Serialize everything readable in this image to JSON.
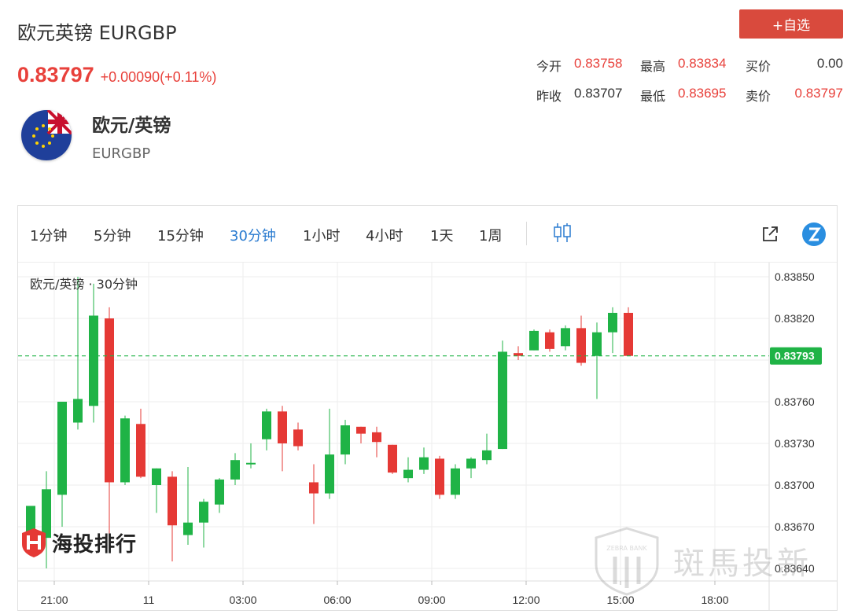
{
  "header": {
    "title": "欧元英镑 EURGBP",
    "price": "0.83797",
    "change": "+0.00090(+0.11%)",
    "add_watch": "+自选"
  },
  "quote": {
    "open_label": "今开",
    "open": "0.83758",
    "high_label": "最高",
    "high": "0.83834",
    "bid_label": "买价",
    "bid": "0.00",
    "prev_label": "昨收",
    "prev": "0.83707",
    "low_label": "最低",
    "low": "0.83695",
    "ask_label": "卖价",
    "ask": "0.83797"
  },
  "pair": {
    "name": "欧元/英镑",
    "code": "EURGBP"
  },
  "toolbar": {
    "timeframes": [
      "1分钟",
      "5分钟",
      "15分钟",
      "30分钟",
      "1小时",
      "4小时",
      "1天",
      "1周"
    ],
    "active": "30分钟"
  },
  "chart_label": "欧元/英镑 · 30分钟",
  "watermarks": {
    "left": "海投排行",
    "right": "斑馬投新",
    "badge": "ZEBRA BANK"
  },
  "colors": {
    "up": "#1fb346",
    "down": "#e53935",
    "accent": "#2a7bd0",
    "brand": "#d94a3d"
  },
  "chart_data": {
    "type": "candlestick",
    "ylim": [
      0.83625,
      0.83855
    ],
    "yticks": [
      "0.83850",
      "0.83820",
      "0.83790",
      "0.83760",
      "0.83730",
      "0.83700",
      "0.83670",
      "0.83640"
    ],
    "xticks": [
      {
        "label": "21:00",
        "index": 1.5
      },
      {
        "label": "11",
        "index": 7.5
      },
      {
        "label": "03:00",
        "index": 13.5
      },
      {
        "label": "06:00",
        "index": 19.5
      },
      {
        "label": "09:00",
        "index": 25.5
      },
      {
        "label": "12:00",
        "index": 31.5
      },
      {
        "label": "15:00",
        "index": 37.5
      },
      {
        "label": "18:00",
        "index": 43.5
      }
    ],
    "last_price": "0.83793",
    "last_value": 0.83793,
    "candles": [
      {
        "o": 0.8366,
        "h": 0.83685,
        "l": 0.8365,
        "c": 0.83685
      },
      {
        "o": 0.83662,
        "h": 0.8371,
        "l": 0.8364,
        "c": 0.83697
      },
      {
        "o": 0.83693,
        "h": 0.8376,
        "l": 0.8367,
        "c": 0.8376
      },
      {
        "o": 0.83745,
        "h": 0.8385,
        "l": 0.8374,
        "c": 0.83762
      },
      {
        "o": 0.83757,
        "h": 0.83845,
        "l": 0.83745,
        "c": 0.83822
      },
      {
        "o": 0.8382,
        "h": 0.83828,
        "l": 0.83665,
        "c": 0.83702
      },
      {
        "o": 0.83702,
        "h": 0.8375,
        "l": 0.837,
        "c": 0.83748
      },
      {
        "o": 0.83744,
        "h": 0.83755,
        "l": 0.83705,
        "c": 0.83706
      },
      {
        "o": 0.837,
        "h": 0.83712,
        "l": 0.8368,
        "c": 0.83712
      },
      {
        "o": 0.83706,
        "h": 0.8371,
        "l": 0.83645,
        "c": 0.83671
      },
      {
        "o": 0.83664,
        "h": 0.83713,
        "l": 0.83657,
        "c": 0.83673
      },
      {
        "o": 0.83673,
        "h": 0.8369,
        "l": 0.83655,
        "c": 0.83688
      },
      {
        "o": 0.83686,
        "h": 0.83705,
        "l": 0.8368,
        "c": 0.83704
      },
      {
        "o": 0.83704,
        "h": 0.83723,
        "l": 0.837,
        "c": 0.83718
      },
      {
        "o": 0.83715,
        "h": 0.8373,
        "l": 0.83712,
        "c": 0.83716
      },
      {
        "o": 0.83733,
        "h": 0.83755,
        "l": 0.83725,
        "c": 0.83753
      },
      {
        "o": 0.83753,
        "h": 0.83757,
        "l": 0.8371,
        "c": 0.8373
      },
      {
        "o": 0.8374,
        "h": 0.83745,
        "l": 0.83725,
        "c": 0.83728
      },
      {
        "o": 0.83702,
        "h": 0.83715,
        "l": 0.83672,
        "c": 0.83694
      },
      {
        "o": 0.83694,
        "h": 0.83755,
        "l": 0.8369,
        "c": 0.83722
      },
      {
        "o": 0.83722,
        "h": 0.83747,
        "l": 0.83715,
        "c": 0.83743
      },
      {
        "o": 0.83742,
        "h": 0.83742,
        "l": 0.8373,
        "c": 0.83737
      },
      {
        "o": 0.83738,
        "h": 0.83742,
        "l": 0.8372,
        "c": 0.83731
      },
      {
        "o": 0.83729,
        "h": 0.83729,
        "l": 0.83708,
        "c": 0.83709
      },
      {
        "o": 0.83705,
        "h": 0.8372,
        "l": 0.83702,
        "c": 0.83711
      },
      {
        "o": 0.83711,
        "h": 0.83727,
        "l": 0.83708,
        "c": 0.8372
      },
      {
        "o": 0.83719,
        "h": 0.83721,
        "l": 0.8369,
        "c": 0.83693
      },
      {
        "o": 0.83693,
        "h": 0.83715,
        "l": 0.8369,
        "c": 0.83712
      },
      {
        "o": 0.83712,
        "h": 0.8372,
        "l": 0.83705,
        "c": 0.83719
      },
      {
        "o": 0.83718,
        "h": 0.83737,
        "l": 0.83715,
        "c": 0.83725
      },
      {
        "o": 0.83726,
        "h": 0.83804,
        "l": 0.83726,
        "c": 0.83796
      },
      {
        "o": 0.83795,
        "h": 0.838,
        "l": 0.8379,
        "c": 0.83793
      },
      {
        "o": 0.83797,
        "h": 0.83812,
        "l": 0.83797,
        "c": 0.83811
      },
      {
        "o": 0.8381,
        "h": 0.83812,
        "l": 0.83796,
        "c": 0.83798
      },
      {
        "o": 0.838,
        "h": 0.83815,
        "l": 0.83797,
        "c": 0.83813
      },
      {
        "o": 0.83813,
        "h": 0.83822,
        "l": 0.83786,
        "c": 0.83788
      },
      {
        "o": 0.83793,
        "h": 0.83817,
        "l": 0.83762,
        "c": 0.8381
      },
      {
        "o": 0.8381,
        "h": 0.83828,
        "l": 0.83795,
        "c": 0.83824
      },
      {
        "o": 0.83824,
        "h": 0.83828,
        "l": 0.83793,
        "c": 0.83793
      }
    ]
  }
}
